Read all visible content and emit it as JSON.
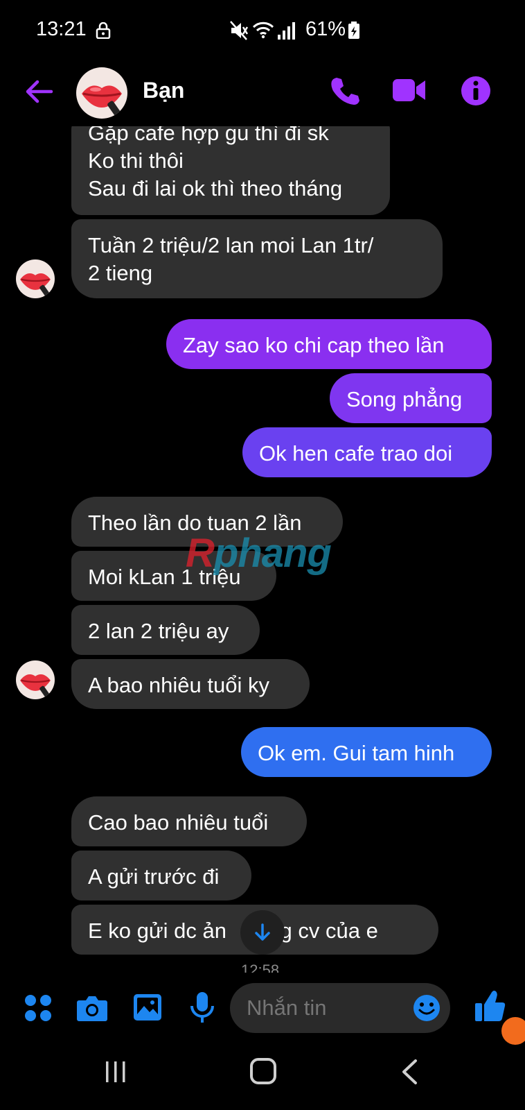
{
  "status_bar": {
    "time": "13:21",
    "battery": "61%"
  },
  "header": {
    "contact_name": "Bạn"
  },
  "colors": {
    "accent": "#a033ff",
    "outgoing_top": "#8a2ff0",
    "outgoing_blue": "#2f6ff0",
    "incoming": "#303030",
    "composer_icon": "#1d86f0"
  },
  "messages": [
    {
      "from": "in",
      "lines": [
        "Gặp cafe hợp gu thì đi sk",
        "Ko thi thôi",
        "Sau đi lai ok thì theo tháng"
      ]
    },
    {
      "from": "in",
      "lines": [
        "Tuần 2 triệu/2 lan moi Lan 1tr/",
        "2 tieng"
      ]
    },
    {
      "from": "out",
      "lines": [
        "Zay sao ko chi cap theo lần"
      ]
    },
    {
      "from": "out",
      "lines": [
        "Song phẳng"
      ]
    },
    {
      "from": "out",
      "lines": [
        "Ok hen cafe trao doi"
      ]
    },
    {
      "from": "in",
      "lines": [
        "Theo lần do tuan 2 lần"
      ]
    },
    {
      "from": "in",
      "lines": [
        "Moi kLan 1 triệu"
      ]
    },
    {
      "from": "in",
      "lines": [
        "2 lan 2 triệu ay"
      ]
    },
    {
      "from": "in",
      "lines": [
        "A bao nhiêu tuổi ky"
      ]
    },
    {
      "from": "out",
      "lines": [
        "Ok em. Gui tam hinh"
      ]
    },
    {
      "from": "in",
      "lines": [
        "Cao bao nhiêu tuổi"
      ]
    },
    {
      "from": "in",
      "lines": [
        "A gửi trước đi"
      ]
    },
    {
      "from": "in",
      "lines": [
        "E ko gửi dc ản",
        "ởng cv của e"
      ]
    }
  ],
  "watermark": {
    "first": "R",
    "rest": "phang"
  },
  "timestamp": "12:58",
  "composer": {
    "placeholder": "Nhắn tin"
  },
  "icons": [
    "lock-icon",
    "mute-icon",
    "wifi-icon",
    "signal-icon",
    "battery-icon",
    "back-icon",
    "call-icon",
    "video-icon",
    "info-icon",
    "apps-icon",
    "camera-icon",
    "gallery-icon",
    "mic-icon",
    "emoji-icon",
    "like-icon",
    "arrow-down-icon"
  ]
}
